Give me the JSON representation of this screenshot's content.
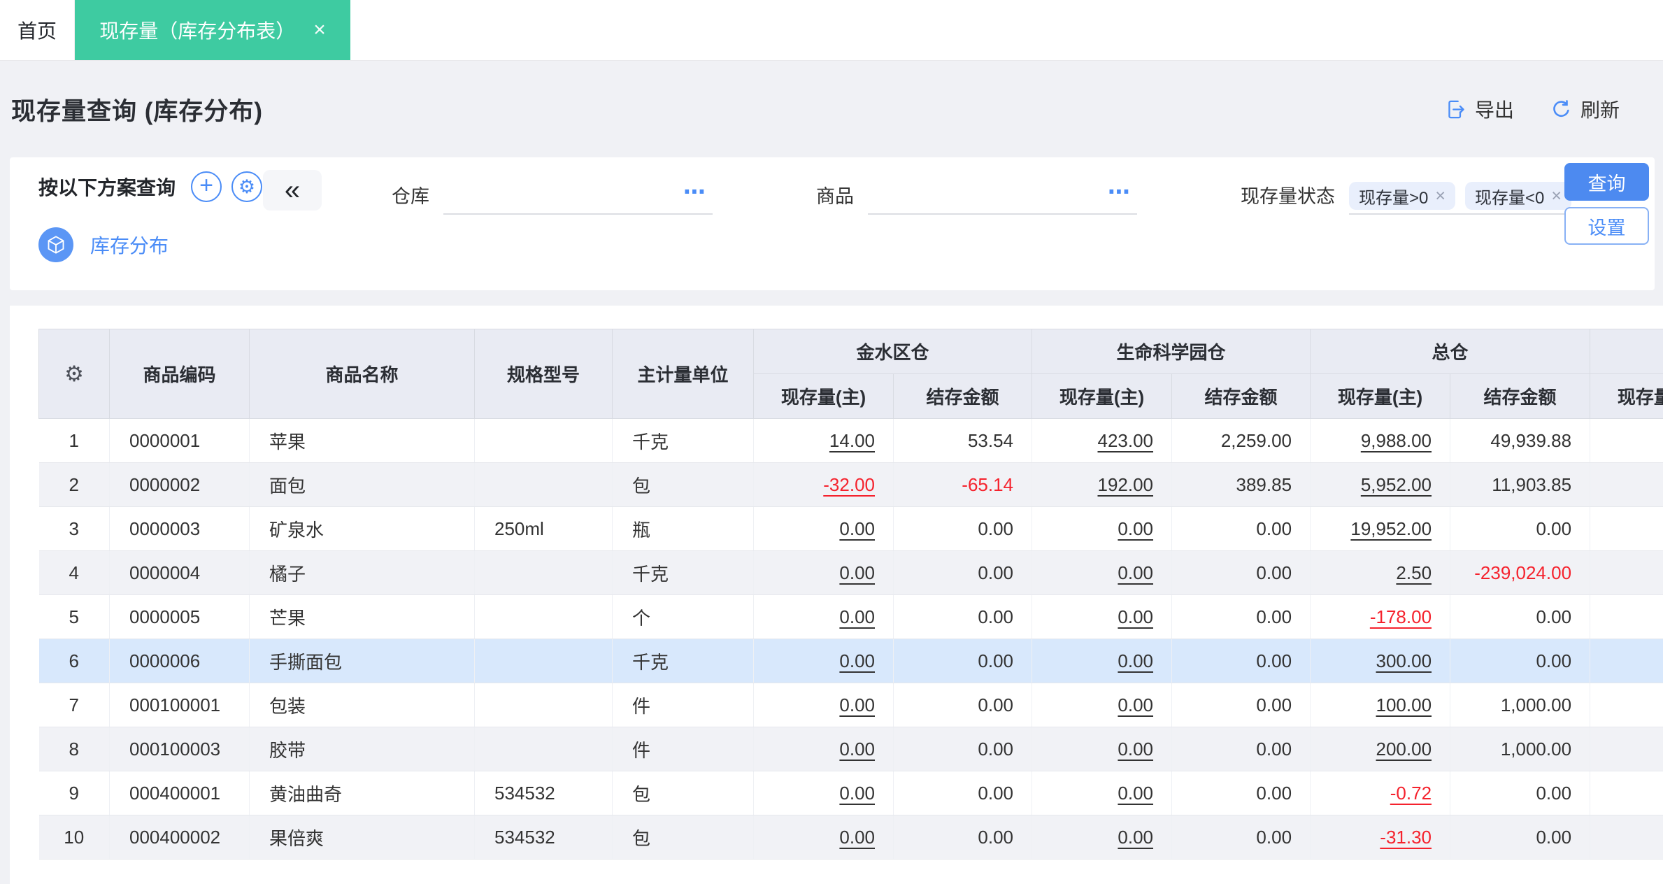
{
  "colors": {
    "accent_green": "#3ecba1",
    "accent_blue": "#4a8cf7",
    "primary_button_blue": "#4d8af0",
    "negative_red": "#f5222d",
    "selected_row_blue": "#d8e8fc"
  },
  "icons": {
    "plus": "+",
    "gear": "⚙",
    "collapse": "«",
    "ellipsis": "⋯",
    "close": "×"
  },
  "tabbar": {
    "home_tab": "首页",
    "active_tab": "现存量（库存分布表）"
  },
  "header": {
    "title": "现存量查询 (库存分布)",
    "export_label": "导出",
    "refresh_label": "刷新"
  },
  "filter": {
    "scheme_title": "按以下方案查询",
    "scheme_link": "库存分布",
    "warehouse_label": "仓库",
    "product_label": "商品",
    "status_label": "现存量状态",
    "status_tags": [
      "现存量>0",
      "现存量<0"
    ],
    "query_button": "查询",
    "settings_button": "设置"
  },
  "table": {
    "fixed_headers": [
      "商品编码",
      "商品名称",
      "规格型号",
      "主计量单位"
    ],
    "groups": [
      {
        "name": "金水区仓",
        "columns": [
          "现存量(主)",
          "结存金额"
        ]
      },
      {
        "name": "生命科学园仓",
        "columns": [
          "现存量(主)",
          "结存金额"
        ]
      },
      {
        "name": "总仓",
        "columns": [
          "现存量(主)",
          "结存金额"
        ]
      },
      {
        "name": "",
        "columns": [
          "现存量(主)"
        ]
      }
    ],
    "rows": [
      {
        "index": 1,
        "code": "0000001",
        "name": "苹果",
        "spec": "",
        "unit": "千克",
        "selected": false,
        "values": [
          {
            "v": "14.00",
            "link": true
          },
          {
            "v": "53.54"
          },
          {
            "v": "423.00",
            "link": true
          },
          {
            "v": "2,259.00"
          },
          {
            "v": "9,988.00",
            "link": true
          },
          {
            "v": "49,939.88"
          }
        ]
      },
      {
        "index": 2,
        "code": "0000002",
        "name": "面包",
        "spec": "",
        "unit": "包",
        "selected": false,
        "values": [
          {
            "v": "-32.00",
            "link": true,
            "neg": true
          },
          {
            "v": "-65.14",
            "neg": true
          },
          {
            "v": "192.00",
            "link": true
          },
          {
            "v": "389.85"
          },
          {
            "v": "5,952.00",
            "link": true
          },
          {
            "v": "11,903.85"
          }
        ]
      },
      {
        "index": 3,
        "code": "0000003",
        "name": "矿泉水",
        "spec": "250ml",
        "unit": "瓶",
        "selected": false,
        "values": [
          {
            "v": "0.00",
            "link": true
          },
          {
            "v": "0.00"
          },
          {
            "v": "0.00",
            "link": true
          },
          {
            "v": "0.00"
          },
          {
            "v": "19,952.00",
            "link": true
          },
          {
            "v": "0.00"
          }
        ]
      },
      {
        "index": 4,
        "code": "0000004",
        "name": "橘子",
        "spec": "",
        "unit": "千克",
        "selected": false,
        "values": [
          {
            "v": "0.00",
            "link": true
          },
          {
            "v": "0.00"
          },
          {
            "v": "0.00",
            "link": true
          },
          {
            "v": "0.00"
          },
          {
            "v": "2.50",
            "link": true
          },
          {
            "v": "-239,024.00",
            "neg": true
          }
        ]
      },
      {
        "index": 5,
        "code": "0000005",
        "name": "芒果",
        "spec": "",
        "unit": "个",
        "selected": false,
        "values": [
          {
            "v": "0.00",
            "link": true
          },
          {
            "v": "0.00"
          },
          {
            "v": "0.00",
            "link": true
          },
          {
            "v": "0.00"
          },
          {
            "v": "-178.00",
            "link": true,
            "neg": true
          },
          {
            "v": "0.00"
          }
        ]
      },
      {
        "index": 6,
        "code": "0000006",
        "name": "手撕面包",
        "spec": "",
        "unit": "千克",
        "selected": true,
        "values": [
          {
            "v": "0.00",
            "link": true
          },
          {
            "v": "0.00"
          },
          {
            "v": "0.00",
            "link": true
          },
          {
            "v": "0.00"
          },
          {
            "v": "300.00",
            "link": true
          },
          {
            "v": "0.00"
          }
        ]
      },
      {
        "index": 7,
        "code": "000100001",
        "name": "包装",
        "spec": "",
        "unit": "件",
        "selected": false,
        "values": [
          {
            "v": "0.00",
            "link": true
          },
          {
            "v": "0.00"
          },
          {
            "v": "0.00",
            "link": true
          },
          {
            "v": "0.00"
          },
          {
            "v": "100.00",
            "link": true
          },
          {
            "v": "1,000.00"
          }
        ]
      },
      {
        "index": 8,
        "code": "000100003",
        "name": "胶带",
        "spec": "",
        "unit": "件",
        "selected": false,
        "values": [
          {
            "v": "0.00",
            "link": true
          },
          {
            "v": "0.00"
          },
          {
            "v": "0.00",
            "link": true
          },
          {
            "v": "0.00"
          },
          {
            "v": "200.00",
            "link": true
          },
          {
            "v": "1,000.00"
          }
        ]
      },
      {
        "index": 9,
        "code": "000400001",
        "name": "黄油曲奇",
        "spec": "534532",
        "unit": "包",
        "selected": false,
        "values": [
          {
            "v": "0.00",
            "link": true
          },
          {
            "v": "0.00"
          },
          {
            "v": "0.00",
            "link": true
          },
          {
            "v": "0.00"
          },
          {
            "v": "-0.72",
            "link": true,
            "neg": true
          },
          {
            "v": "0.00"
          }
        ]
      },
      {
        "index": 10,
        "code": "000400002",
        "name": "果倍爽",
        "spec": "534532",
        "unit": "包",
        "selected": false,
        "values": [
          {
            "v": "0.00",
            "link": true
          },
          {
            "v": "0.00"
          },
          {
            "v": "0.00",
            "link": true
          },
          {
            "v": "0.00"
          },
          {
            "v": "-31.30",
            "link": true,
            "neg": true
          },
          {
            "v": "0.00"
          }
        ]
      }
    ]
  }
}
